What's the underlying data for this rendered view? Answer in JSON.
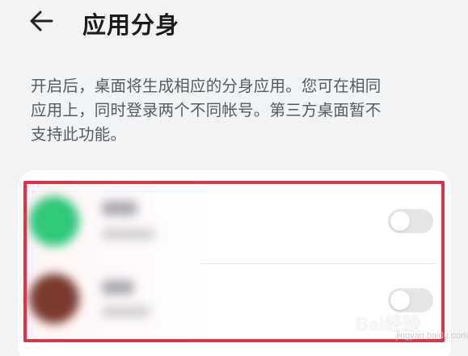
{
  "header": {
    "title": "应用分身"
  },
  "description": {
    "line1": "开启后，桌面将生成相应的分身应用。您可在相同",
    "line2": "应用上，同时登录两个不同帐号。第三方桌面暂不",
    "line3": "支持此功能。"
  },
  "apps": [
    {
      "name": "",
      "subtitle": "",
      "enabled": false,
      "icon": "app-icon-green"
    },
    {
      "name": "",
      "subtitle": "",
      "enabled": false,
      "icon": "app-icon-avatar"
    }
  ],
  "watermark": {
    "text": "Bai经验",
    "sub": "jingyan.baidu.com"
  },
  "colors": {
    "background": "#f1f3f5",
    "card": "#ffffff",
    "highlight": "#d8344c",
    "toggle_off": "#e3e5e7"
  }
}
